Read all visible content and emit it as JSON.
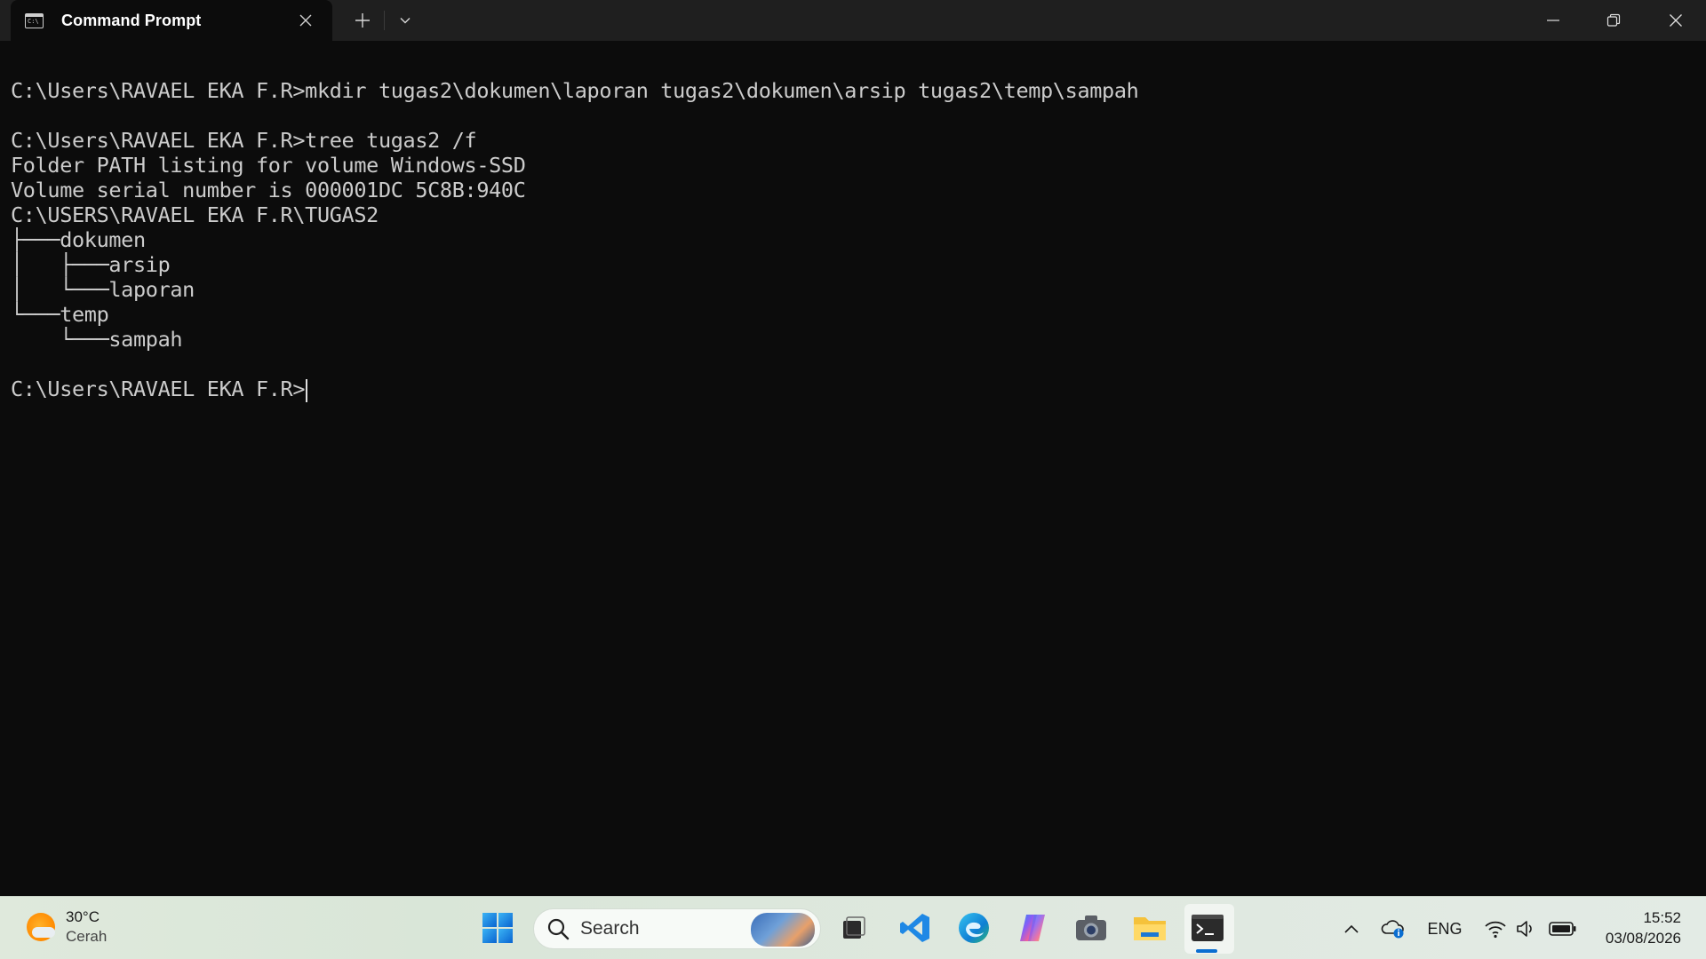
{
  "window": {
    "tab_title": "Command Prompt",
    "tab_icon_glyph": "C:\\"
  },
  "terminal": {
    "lines": [
      "",
      "C:\\Users\\RAVAEL EKA F.R>mkdir tugas2\\dokumen\\laporan tugas2\\dokumen\\arsip tugas2\\temp\\sampah",
      "",
      "C:\\Users\\RAVAEL EKA F.R>tree tugas2 /f",
      "Folder PATH listing for volume Windows-SSD",
      "Volume serial number is 000001DC 5C8B:940C",
      "C:\\USERS\\RAVAEL EKA F.R\\TUGAS2",
      "├───dokumen",
      "│   ├───arsip",
      "│   └───laporan",
      "└───temp",
      "    └───sampah",
      "",
      "C:\\Users\\RAVAEL EKA F.R>"
    ]
  },
  "taskbar": {
    "weather_temp": "30°C",
    "weather_desc": "Cerah",
    "search_label": "Search",
    "apps": [
      "start-icon",
      "search-icon",
      "task-view-icon",
      "vscode-icon",
      "edge-icon",
      "copilot-icon",
      "camera-icon",
      "file-explorer-icon",
      "terminal-icon"
    ],
    "tray": {
      "language": "ENG",
      "time": "15:52",
      "date": "03/08/2026"
    }
  },
  "colors": {
    "terminal_bg": "#0c0c0c",
    "terminal_text": "#cccccc",
    "titlebar_bg": "#1f1f1f",
    "accent": "#0a6ed1"
  }
}
